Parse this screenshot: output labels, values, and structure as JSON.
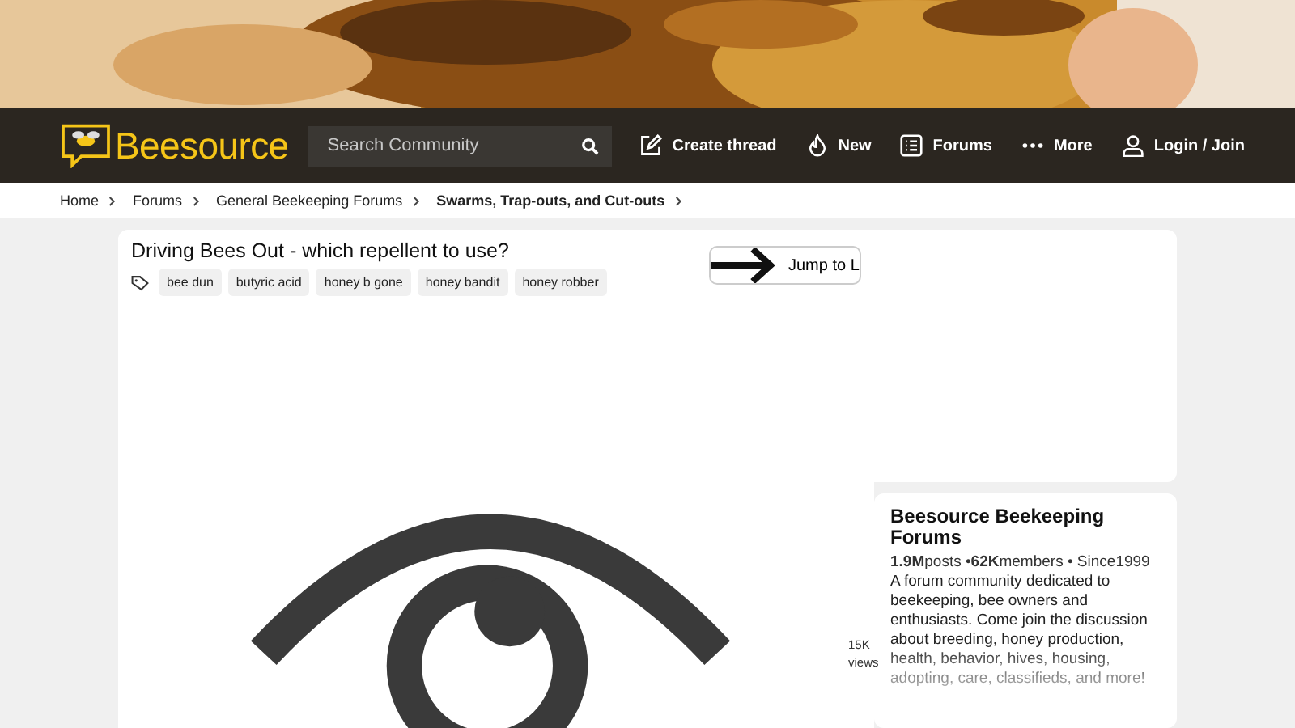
{
  "header": {
    "logo": "Beesource",
    "search": {
      "placeholder": "Search Community"
    },
    "nav": [
      {
        "label": "Create thread",
        "kind": "edit"
      },
      {
        "label": "New",
        "kind": "flame"
      },
      {
        "label": "Forums",
        "kind": "list"
      },
      {
        "label": "More",
        "kind": "dots"
      },
      {
        "label": "Login / Join",
        "kind": "user"
      }
    ]
  },
  "breadcrumbs": [
    {
      "label": "Home",
      "current": false
    },
    {
      "label": "Forums",
      "current": false
    },
    {
      "label": "General Beekeeping Forums",
      "current": false
    },
    {
      "label": "Swarms, Trap-outs, and Cut-outs",
      "current": true
    }
  ],
  "thread": {
    "title": "Driving Bees Out - which repellent to use?",
    "tags": [
      "bee dun",
      "butyric acid",
      "honey b gone",
      "honey bandit",
      "honey robber"
    ],
    "jump_button": "Jump to L",
    "views": "15K",
    "views_label": "views"
  },
  "community": {
    "title": "Beesource Beekeeping Forums",
    "stats": "**1.9M**posts •**62K**members • Since1999",
    "description": "A forum community dedicated to beekeeping, bee owners and enthusiasts. Come join the discussion about breeding, honey production, health, behavior, hives, housing, adopting, care, classifieds, and more!"
  }
}
